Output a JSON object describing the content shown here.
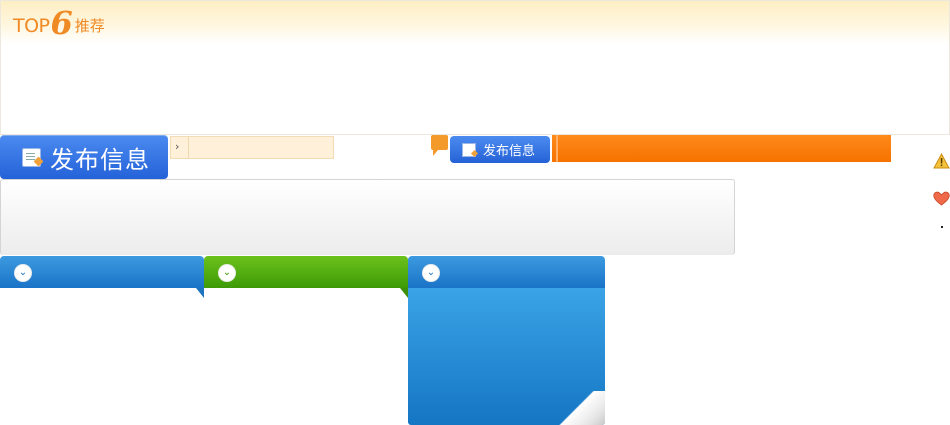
{
  "banner": {
    "logo_top": "TOP",
    "logo_num": "6",
    "logo_suffix": "推荐",
    "color": "#f08a24"
  },
  "publish_large": {
    "label": "发布信息",
    "icon": "edit-icon",
    "color": "#2f6fe0"
  },
  "cream_field": {
    "arrow": "›"
  },
  "publish_small": {
    "label": "发布信息",
    "icon": "edit-icon"
  },
  "side_icons": [
    "warning-icon",
    "heart-icon"
  ],
  "tabs": [
    {
      "icon": "chevron-down-icon",
      "glyph": "⌄",
      "color": "#1a73c7"
    },
    {
      "icon": "chevron-down-icon",
      "glyph": "⌄",
      "color": "#3d9a07"
    },
    {
      "icon": "chevron-down-icon",
      "glyph": "⌄",
      "color": "#1a73c7"
    }
  ],
  "colors": {
    "orange": "#f57200",
    "blue": "#1a73c7",
    "green": "#3d9a07"
  }
}
